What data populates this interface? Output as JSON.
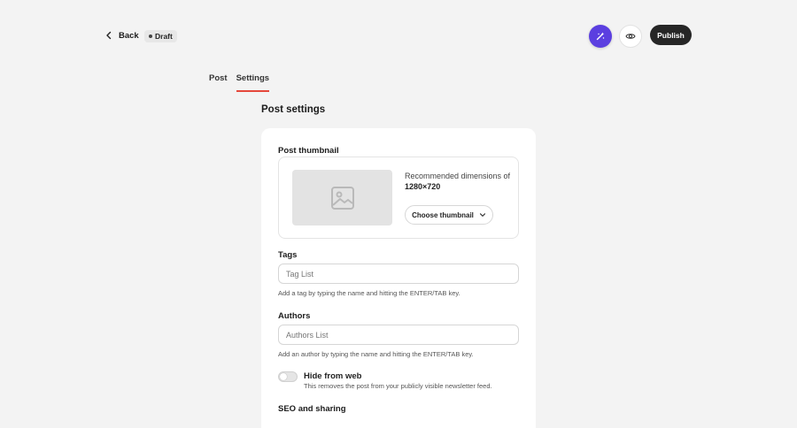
{
  "header": {
    "back_label": "Back",
    "draft_label": "Draft",
    "publish_label": "Publish"
  },
  "tabs": [
    {
      "label": "Post",
      "active": false
    },
    {
      "label": "Settings",
      "active": true
    }
  ],
  "page_title": "Post settings",
  "thumbnail": {
    "heading": "Post thumbnail",
    "recommended_text": "Recommended dimensions of",
    "dimensions": "1280×720",
    "choose_label": "Choose thumbnail"
  },
  "tags": {
    "heading": "Tags",
    "placeholder": "Tag List",
    "value": "",
    "hint": "Add a tag by typing the name and hitting the ENTER/TAB key."
  },
  "authors": {
    "heading": "Authors",
    "placeholder": "Authors List",
    "value": "",
    "hint": "Add an author by typing the name and hitting the ENTER/TAB key."
  },
  "hide_from_web": {
    "title": "Hide from web",
    "description": "This removes the post from your publicly visible newsletter feed.",
    "enabled": false
  },
  "seo": {
    "heading": "SEO and sharing"
  },
  "colors": {
    "accent_tab": "#e5483b",
    "ai_button": "#5b3fe0",
    "publish_button": "#262626",
    "background": "#f3f3f3"
  },
  "icons": {
    "back": "chevron-left-icon",
    "ai": "magic-wand-icon",
    "preview": "eye-icon",
    "thumbnail_placeholder": "image-icon",
    "dropdown": "chevron-down-icon"
  }
}
